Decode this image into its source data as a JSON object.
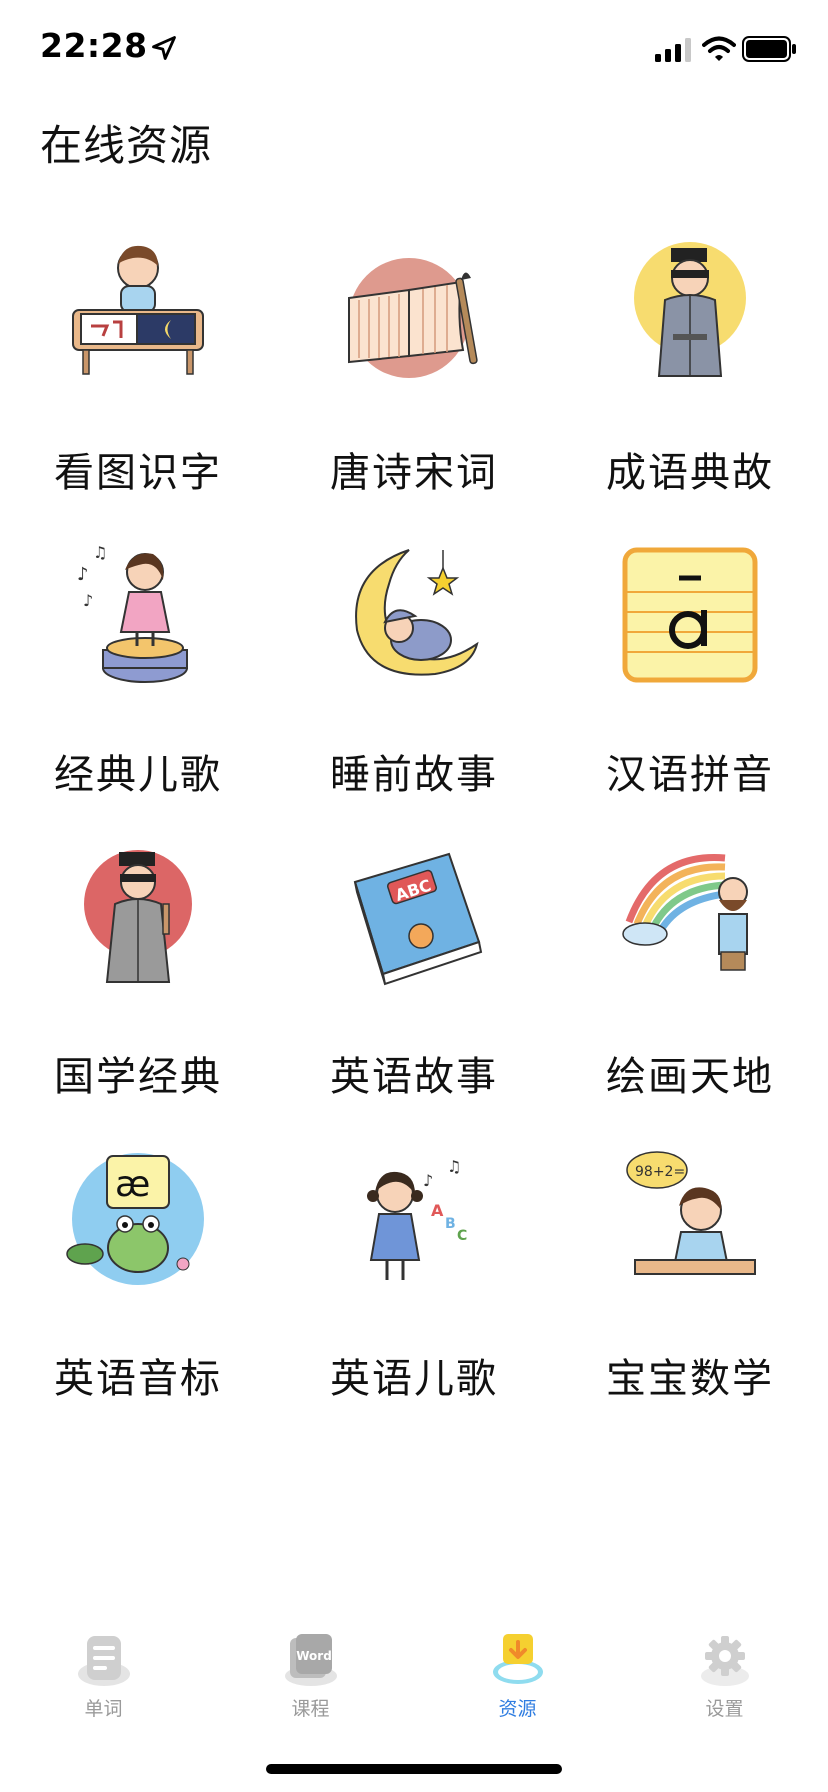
{
  "status_bar": {
    "time": "22:28",
    "icons": [
      "location-arrow-icon",
      "cellular-signal-icon",
      "wifi-icon",
      "battery-icon"
    ]
  },
  "header": {
    "title": "在线资源"
  },
  "resources": [
    {
      "label": "看图识字",
      "icon": "child-drawing-illustration"
    },
    {
      "label": "唐诗宋词",
      "icon": "poetry-book-illustration"
    },
    {
      "label": "成语典故",
      "icon": "ancient-scholar-illustration"
    },
    {
      "label": "经典儿歌",
      "icon": "singing-girl-illustration"
    },
    {
      "label": "睡前故事",
      "icon": "moon-sleeping-baby-illustration"
    },
    {
      "label": "汉语拼音",
      "icon": "pinyin-card-illustration"
    },
    {
      "label": "国学经典",
      "icon": "classical-scholar-illustration"
    },
    {
      "label": "英语故事",
      "icon": "abc-book-illustration"
    },
    {
      "label": "绘画天地",
      "icon": "rainbow-painter-illustration"
    },
    {
      "label": "英语音标",
      "icon": "phonetic-frog-illustration"
    },
    {
      "label": "英语儿歌",
      "icon": "english-song-girl-illustration"
    },
    {
      "label": "宝宝数学",
      "icon": "math-boy-illustration"
    }
  ],
  "tab_bar": {
    "tabs": [
      {
        "label": "单词",
        "icon": "word-list-icon",
        "active": false
      },
      {
        "label": "课程",
        "icon": "word-card-icon",
        "icon_text": "Word",
        "active": false
      },
      {
        "label": "资源",
        "icon": "cloud-download-icon",
        "active": true
      },
      {
        "label": "设置",
        "icon": "gear-icon",
        "active": false
      }
    ]
  },
  "colors": {
    "active_tab": "#2f7de1",
    "inactive_tab": "#9a9a9a",
    "background": "#ffffff"
  }
}
